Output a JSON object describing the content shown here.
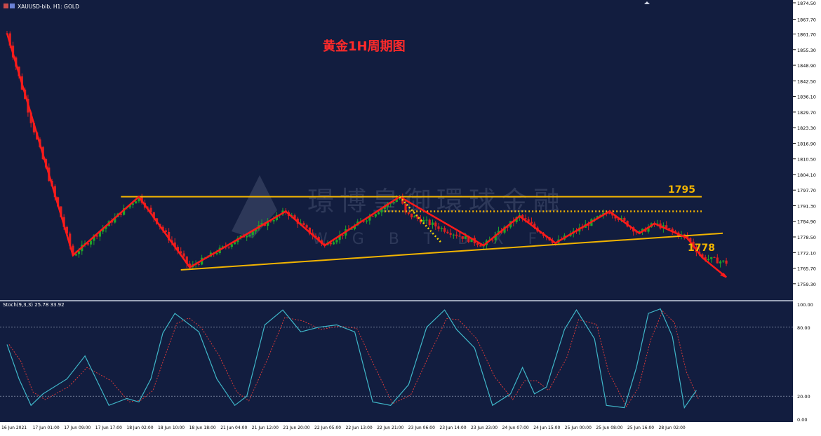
{
  "window": {
    "title": "XAUUSD-bib, H1:  GOLD"
  },
  "colors": {
    "background": "#121d3f",
    "axis_bg": "#ffffff",
    "bull": "#1fa52a",
    "bear": "#e02020",
    "resistance": "#f2b400",
    "trend": "#ff1a1a",
    "stoch_main": "#3fb6c8",
    "stoch_signal": "#d83a3a"
  },
  "watermark": {
    "line1": "璟博皇御環球金融",
    "line2": "W  G  B  T  B  X  F"
  },
  "annotations": {
    "title": "黄金1H周期图",
    "level_high": "1795",
    "level_low": "1778"
  },
  "chart_data": [
    {
      "type": "candlestick",
      "symbol": "XAUUSD-bib",
      "timeframe": "H1",
      "ylim": [
        1753.5,
        1874.5
      ],
      "y_ticks": [
        "1874.50",
        "1867.70",
        "1861.70",
        "1855.30",
        "1848.90",
        "1842.50",
        "1836.10",
        "1829.70",
        "1823.30",
        "1816.90",
        "1810.50",
        "1804.10",
        "1797.70",
        "1791.30",
        "1784.90",
        "1778.50",
        "1772.10",
        "1765.70",
        "1759.30"
      ],
      "x_ticks": [
        "16 Jun 2021",
        "17 Jun 01:00",
        "17 Jun 09:00",
        "17 Jun 17:00",
        "18 Jun 02:00",
        "18 Jun 10:00",
        "18 Jun 18:00",
        "21 Jun 04:00",
        "21 Jun 12:00",
        "21 Jun 20:00",
        "22 Jun 05:00",
        "22 Jun 13:00",
        "22 Jun 21:00",
        "23 Jun 06:00",
        "23 Jun 14:00",
        "23 Jun 23:00",
        "24 Jun 07:00",
        "24 Jun 15:00",
        "25 Jun 00:00",
        "25 Jun 08:00",
        "25 Jun 16:00",
        "28 Jun 02:00"
      ],
      "path_keypoints": [
        {
          "x": 0,
          "y": 1862
        },
        {
          "x": 8,
          "y": 1826
        },
        {
          "x": 22,
          "y": 1771
        },
        {
          "x": 44,
          "y": 1795
        },
        {
          "x": 61,
          "y": 1766
        },
        {
          "x": 93,
          "y": 1789
        },
        {
          "x": 106,
          "y": 1775
        },
        {
          "x": 131,
          "y": 1795
        },
        {
          "x": 133,
          "y": 1788
        },
        {
          "x": 159,
          "y": 1775
        },
        {
          "x": 171,
          "y": 1787
        },
        {
          "x": 183,
          "y": 1776
        },
        {
          "x": 201,
          "y": 1789
        },
        {
          "x": 211,
          "y": 1780
        },
        {
          "x": 216,
          "y": 1784
        },
        {
          "x": 227,
          "y": 1778
        },
        {
          "x": 232,
          "y": 1770
        },
        {
          "x": 240,
          "y": 1768
        }
      ],
      "horizontal_levels": [
        {
          "value": 1795,
          "style": "solid"
        },
        {
          "value": 1789,
          "style": "dotted"
        }
      ],
      "support_line": {
        "from": {
          "x": 58,
          "y": 1765
        },
        "to": {
          "x": 238,
          "y": 1780
        }
      }
    },
    {
      "type": "line",
      "title": "Stoch(9,3,3) 25.78 33.92",
      "ylim": [
        0,
        100
      ],
      "y_ticks": [
        "100.00",
        "80.00",
        "20.00",
        "0.00"
      ],
      "levels": [
        80,
        20
      ],
      "series": [
        {
          "name": "main",
          "x": [
            0,
            4,
            8,
            12,
            20,
            26,
            34,
            40,
            44,
            48,
            52,
            56,
            60,
            64,
            70,
            76,
            80,
            86,
            92,
            98,
            104,
            110,
            116,
            122,
            128,
            134,
            140,
            146,
            150,
            156,
            162,
            168,
            172,
            176,
            180,
            186,
            190,
            196,
            200,
            206,
            210,
            214,
            218,
            222,
            226,
            230
          ],
          "values": [
            65,
            35,
            12,
            22,
            35,
            55,
            12,
            18,
            15,
            35,
            75,
            92,
            84,
            76,
            35,
            12,
            20,
            82,
            95,
            76,
            80,
            82,
            76,
            15,
            12,
            30,
            80,
            95,
            78,
            62,
            12,
            22,
            45,
            22,
            28,
            78,
            95,
            70,
            12,
            10,
            45,
            92,
            96,
            72,
            10,
            25
          ]
        }
      ]
    }
  ]
}
